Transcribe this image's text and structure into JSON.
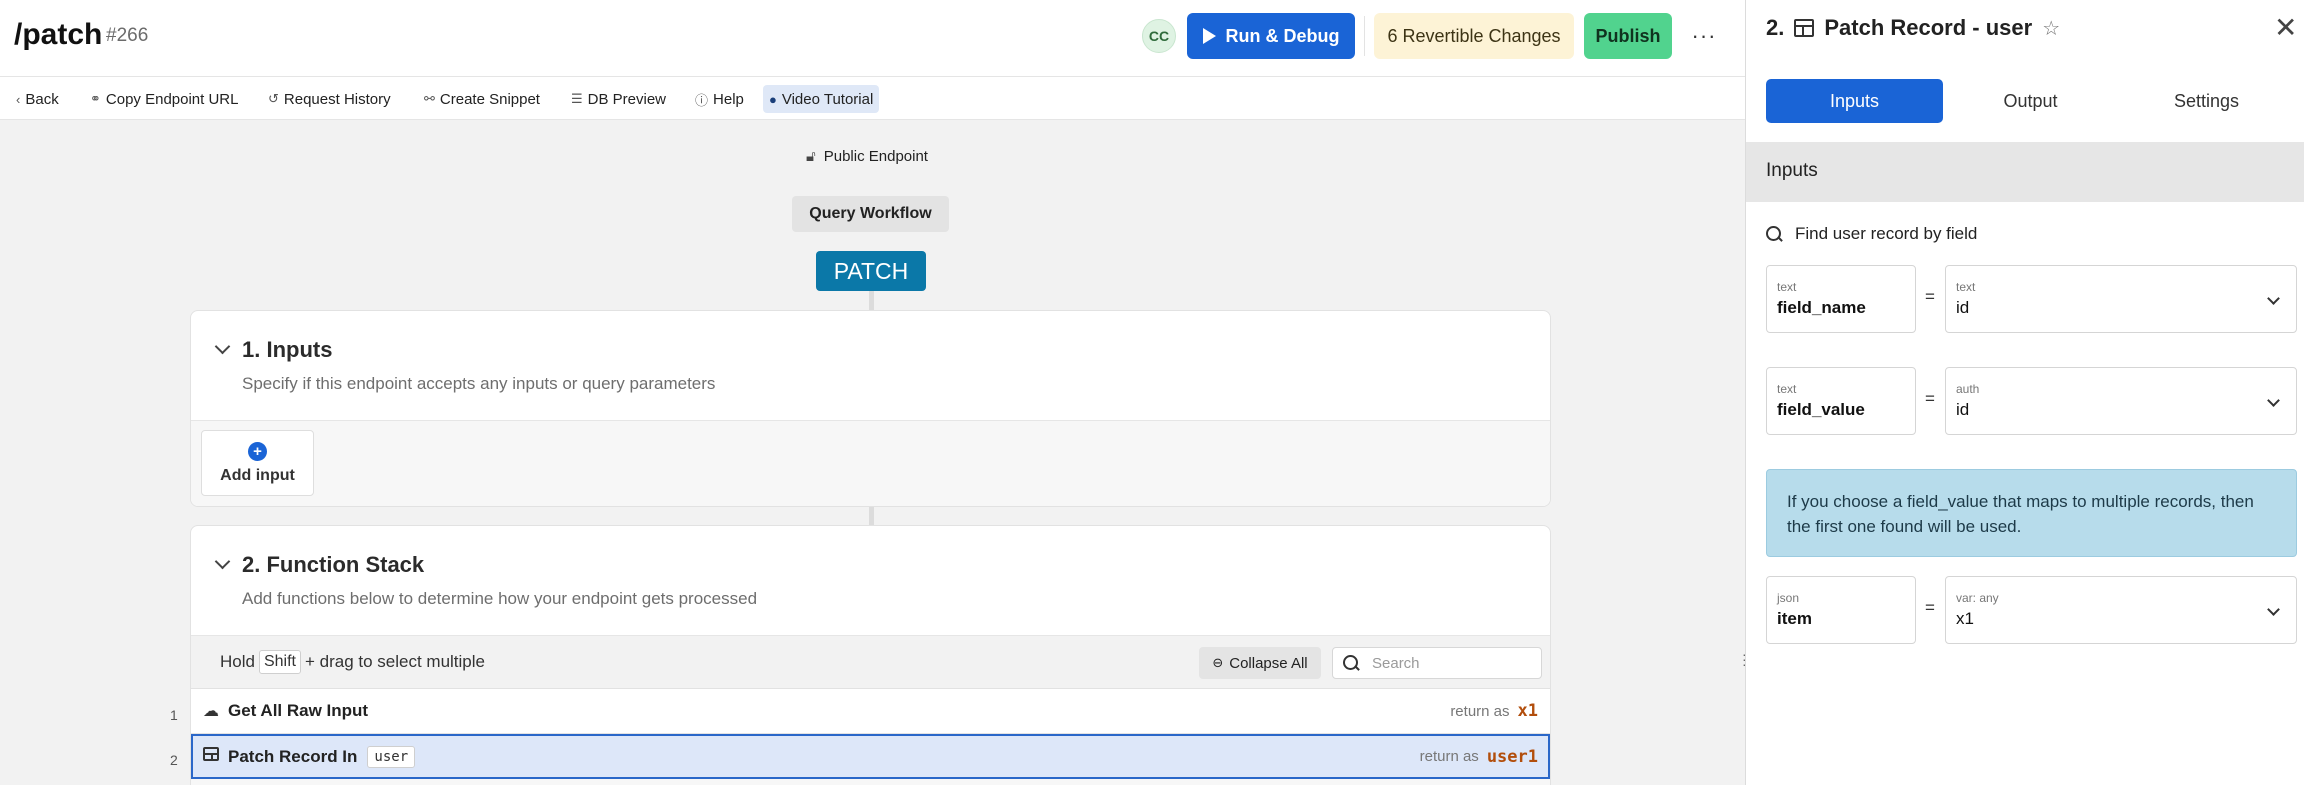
{
  "header": {
    "title": "/patch",
    "endpoint_id": "#266",
    "avatar_initials": "CC",
    "run_debug_label": "Run & Debug",
    "changes_label": "6 Revertible Changes",
    "publish_label": "Publish",
    "more_label": "···"
  },
  "toolbar": {
    "back": "Back",
    "copy_url": "Copy Endpoint URL",
    "history": "Request History",
    "snippet": "Create Snippet",
    "db_preview": "DB Preview",
    "help": "Help",
    "video": "Video Tutorial"
  },
  "canvas": {
    "public_endpoint": "Public Endpoint",
    "query_workflow": "Query Workflow",
    "method": "PATCH"
  },
  "inputs_card": {
    "title": "1. Inputs",
    "subtitle": "Specify if this endpoint accepts any inputs or query parameters",
    "add_input": "Add input"
  },
  "function_stack": {
    "title": "2. Function Stack",
    "subtitle": "Add functions below to determine how your endpoint gets processed",
    "hold": "Hold",
    "shift_key": "Shift",
    "drag_hint": "+ drag to select multiple",
    "collapse_all": "Collapse All",
    "search_placeholder": "Search",
    "rows": [
      {
        "num": "1",
        "name": "Get All Raw Input",
        "tag": "",
        "return_label": "return as",
        "var": "x1"
      },
      {
        "num": "2",
        "name": "Patch Record In",
        "tag": "user",
        "return_label": "return as",
        "var": "user1"
      }
    ]
  },
  "panel": {
    "title_num": "2.",
    "title": "Patch Record - user",
    "tabs": [
      "Inputs",
      "Output",
      "Settings"
    ],
    "section_title": "Inputs",
    "find_label": "Find user record by field",
    "fields": [
      {
        "type": "text",
        "name": "field_name",
        "value_type": "text",
        "value": "id"
      },
      {
        "type": "text",
        "name": "field_value",
        "value_type": "auth",
        "value": "id"
      },
      {
        "type": "json",
        "name": "item",
        "value_type": "var: any",
        "value": "x1"
      }
    ],
    "equals": "=",
    "info": "If you choose a field_value that maps to multiple records, then the first one found will be used."
  },
  "colors": {
    "primary": "#1a64d6",
    "publish": "#51d38e",
    "changes": "#fdf3d6",
    "method": "#0b78a8",
    "return_var": "#b24e0c",
    "info_bg": "#b7dceb"
  }
}
